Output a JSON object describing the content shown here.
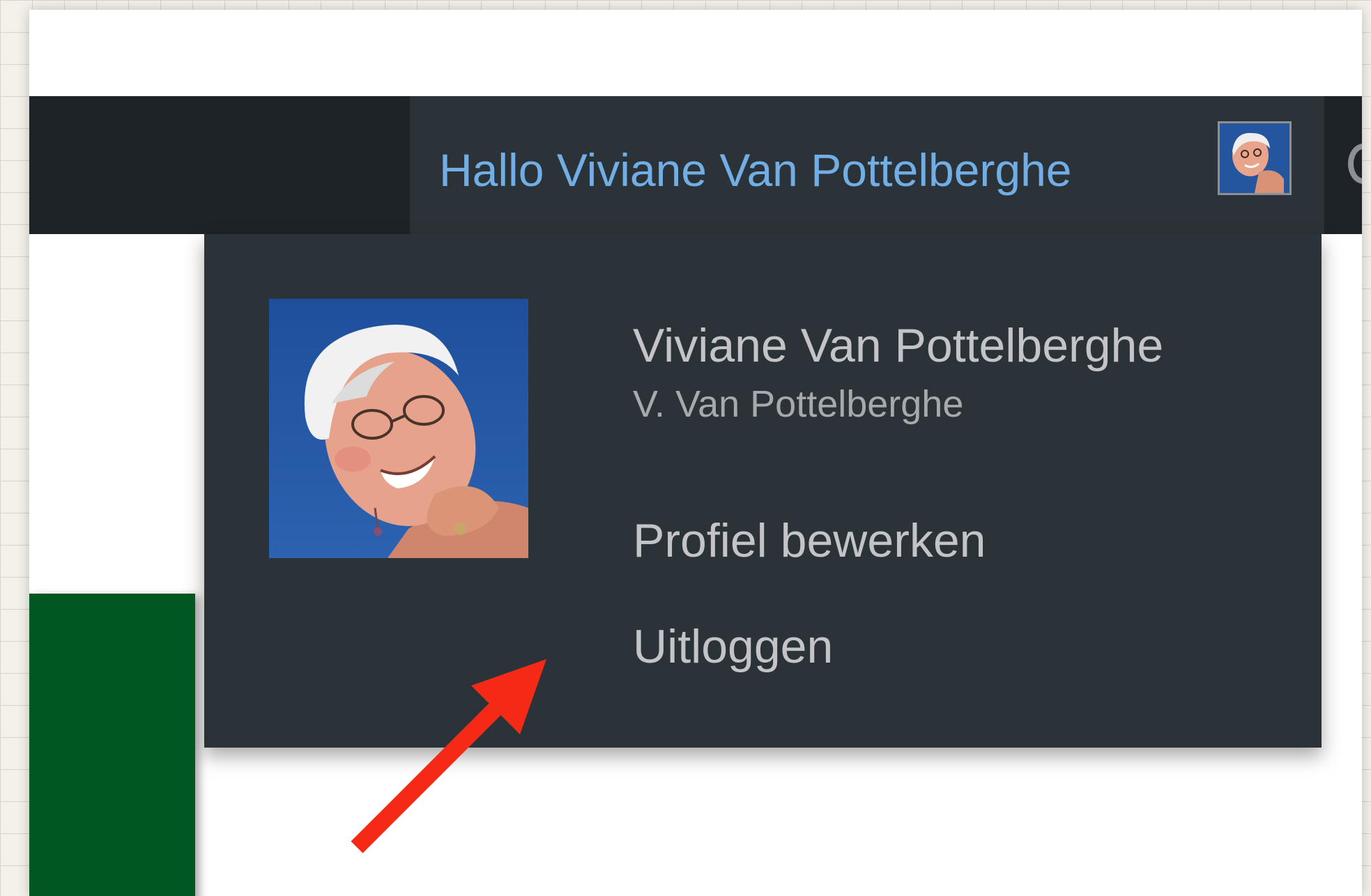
{
  "adminbar": {
    "greeting": "Hallo Viviane Van Pottelberghe"
  },
  "account_menu": {
    "display_name": "Viviane Van Pottelberghe",
    "username": "V. Van Pottelberghe",
    "links": [
      {
        "label": "Profiel bewerken"
      },
      {
        "label": "Uitloggen"
      }
    ]
  },
  "colors": {
    "adminbar_bg": "#1d2327",
    "submenu_bg": "#2c3338",
    "link_hover": "#72aee6",
    "text": "#c3c4c7",
    "annotation_arrow": "#f52a16",
    "green_block": "#015721"
  },
  "icons": {
    "avatar": "user-photo",
    "arrow": "red-annotation-arrow"
  }
}
